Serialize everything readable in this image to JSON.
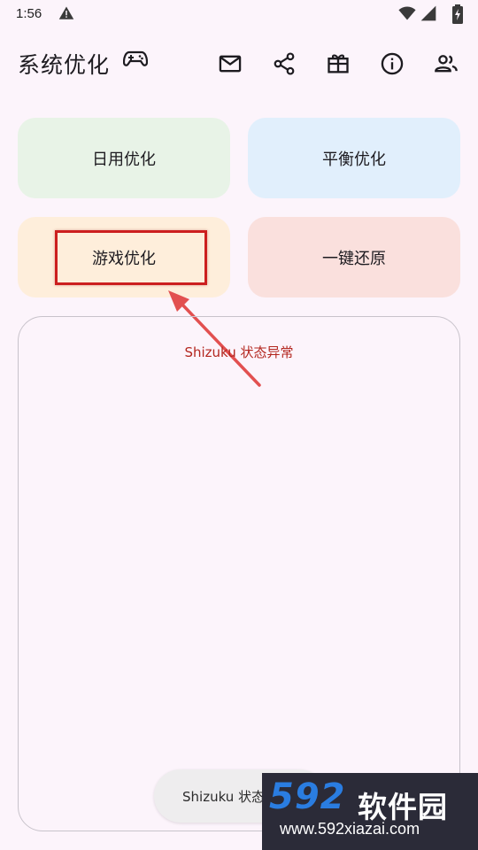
{
  "status_bar": {
    "time": "1:56",
    "icons": [
      "warning-icon",
      "wifi-icon",
      "signal-icon",
      "battery-icon"
    ]
  },
  "app_bar": {
    "title": "系统优化",
    "title_icon": "gamepad-icon",
    "actions": [
      "mail-icon",
      "share-icon",
      "gift-icon",
      "info-icon",
      "people-icon"
    ]
  },
  "tiles": {
    "daily": {
      "label": "日用优化",
      "color": "#e8f3e7"
    },
    "balance": {
      "label": "平衡优化",
      "color": "#e1effc"
    },
    "game": {
      "label": "游戏优化",
      "color": "#feeedb"
    },
    "restore": {
      "label": "一键还原",
      "color": "#fae0dd"
    }
  },
  "log_panel": {
    "status_text": "Shizuku 状态异常",
    "status_color": "#b3261e"
  },
  "toast": {
    "text": "Shizuku 状态"
  },
  "watermark": {
    "number": "592",
    "name": "软件园",
    "url": "www.592xiazai.com"
  },
  "annotation": {
    "highlight_color": "#cc1f1f",
    "arrow_color": "#e25050"
  }
}
